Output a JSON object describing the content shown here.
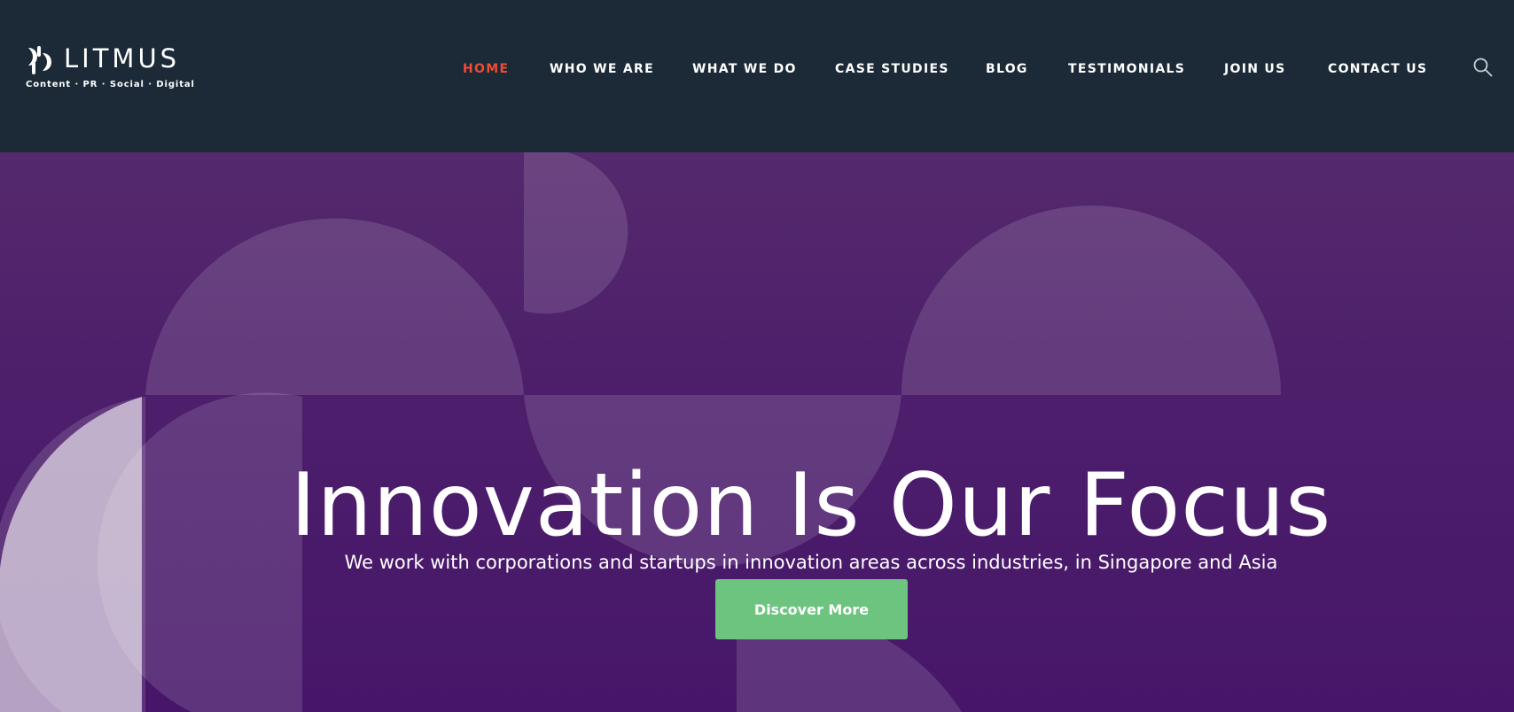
{
  "brand": {
    "name": "LITMUS",
    "tagline": "Content · PR · Social · Digital"
  },
  "nav": {
    "items": [
      {
        "label": "HOME",
        "active": true
      },
      {
        "label": "WHO WE ARE",
        "active": false
      },
      {
        "label": "WHAT WE DO",
        "active": false
      },
      {
        "label": "CASE STUDIES",
        "active": false
      },
      {
        "label": "BLOG",
        "active": false
      },
      {
        "label": "TESTIMONIALS",
        "active": false
      },
      {
        "label": "JOIN US",
        "active": false
      },
      {
        "label": "CONTACT US",
        "active": false
      }
    ],
    "search_icon": "search-icon"
  },
  "hero": {
    "title": "Innovation Is Our Focus",
    "subtitle": "We work with corporations and startups in innovation areas across industries, in Singapore and Asia",
    "cta_label": "Discover More"
  },
  "colors": {
    "header_bg": "#1b2a36",
    "nav_active": "#ef4b35",
    "hero_bg": "#4d1f6b",
    "cta_bg": "#6cc47e"
  }
}
